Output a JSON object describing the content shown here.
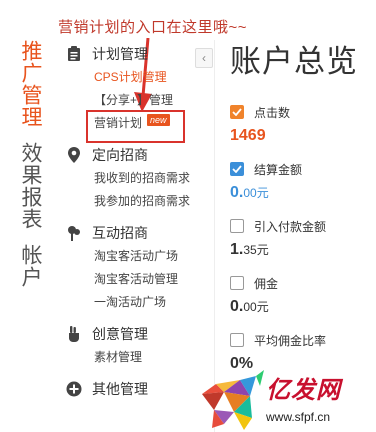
{
  "annotation": "营销计划的入口在这里哦~~",
  "vertical_nav": [
    {
      "label": "推广管理",
      "active": true
    },
    {
      "label": "效果报表",
      "active": false
    },
    {
      "label": "帐户",
      "active": false
    }
  ],
  "menu": {
    "collapse_icon": "chevron-left-icon",
    "groups": [
      {
        "title": "计划管理",
        "icon": "clipboard-icon",
        "items": [
          "CPS计划管理",
          "【分享+】管理",
          "营销计划"
        ]
      },
      {
        "title": "定向招商",
        "icon": "location-pin-icon",
        "items": [
          "我收到的招商需求",
          "我参加的招商需求"
        ]
      },
      {
        "title": "互动招商",
        "icon": "pin-icon",
        "items": [
          "淘宝客活动广场",
          "淘宝客活动管理",
          "一淘活动广场"
        ]
      },
      {
        "title": "创意管理",
        "icon": "thumbs-up-icon",
        "items": [
          "素材管理"
        ]
      },
      {
        "title": "其他管理",
        "icon": "plus-circle-icon",
        "items": []
      }
    ],
    "new_badge": "new"
  },
  "content": {
    "title": "账户总览",
    "metrics": [
      {
        "label": "点击数",
        "checked": true,
        "value_main": "1469",
        "value_unit": "",
        "color": "#e8541e"
      },
      {
        "label": "结算金额",
        "checked": true,
        "value_main": "0.",
        "value_unit": "00元",
        "color": "#3b8fd9"
      },
      {
        "label": "引入付款金额",
        "checked": false,
        "value_main": "1.",
        "value_unit": "35元",
        "color": "#333333"
      },
      {
        "label": "佣金",
        "checked": false,
        "value_main": "0.",
        "value_unit": "00元",
        "color": "#333333"
      },
      {
        "label": "平均佣金比率",
        "checked": false,
        "value_main": "0%",
        "value_unit": "",
        "color": "#333333"
      }
    ]
  },
  "watermark": {
    "brand": "亿发网",
    "url": "www.sfpf.cn"
  }
}
